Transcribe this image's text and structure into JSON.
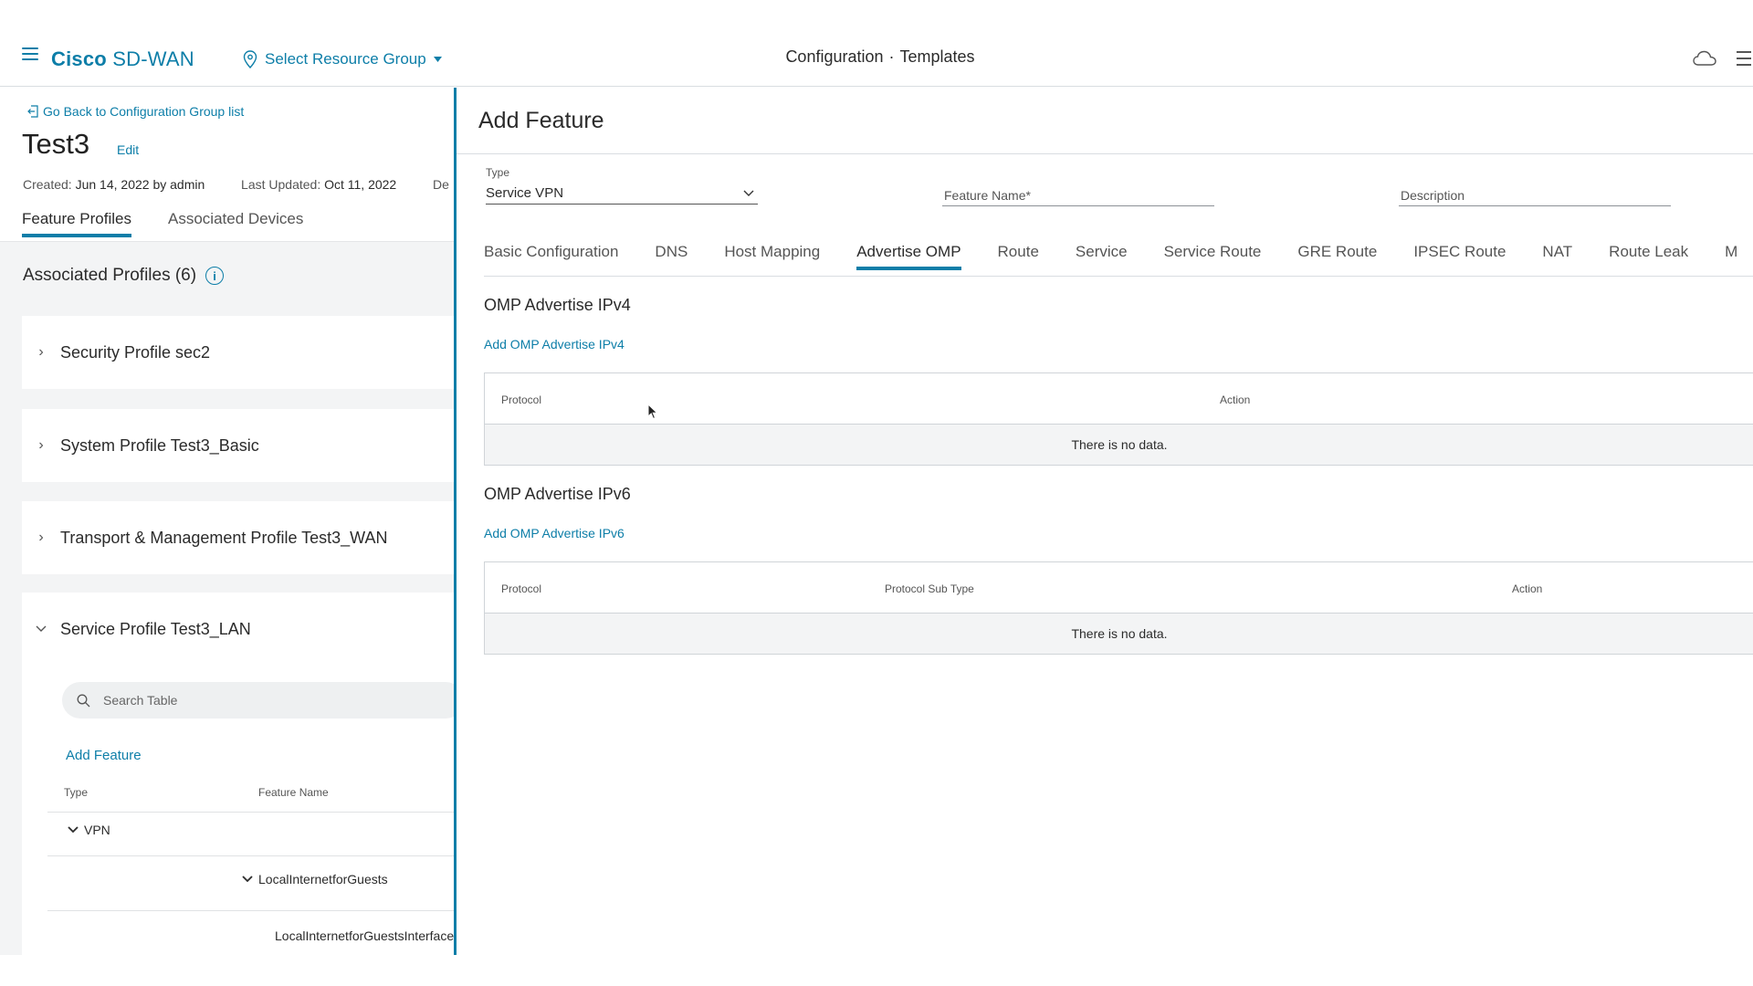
{
  "header": {
    "brand_bold": "Cisco",
    "brand_rest": "SD-WAN",
    "resource_group": "Select Resource Group",
    "title_section": "Configuration",
    "title_separator": "·",
    "title_page": "Templates"
  },
  "left_panel": {
    "back_link": "Go Back to Configuration Group list",
    "group_name": "Test3",
    "edit_label": "Edit",
    "created_label": "Created:",
    "created_value": "Jun 14, 2022 by admin",
    "updated_label": "Last Updated:",
    "updated_value": "Oct 11, 2022",
    "truncated_text": "De",
    "tabs": [
      "Feature Profiles",
      "Associated Devices"
    ],
    "active_tab": "Feature Profiles",
    "associated_profiles_label": "Associated Profiles (6)",
    "profiles": [
      {
        "label": "Security Profile sec2",
        "expanded": false
      },
      {
        "label": "System Profile Test3_Basic",
        "expanded": false
      },
      {
        "label": "Transport & Management Profile Test3_WAN",
        "expanded": false
      },
      {
        "label": "Service Profile Test3_LAN",
        "expanded": true
      }
    ],
    "service_profile": {
      "search_placeholder": "Search Table",
      "add_feature_label": "Add Feature",
      "columns": [
        "Type",
        "Feature Name"
      ],
      "rows": {
        "vpn_label": "VPN",
        "feature_label": "LocalInternetforGuests",
        "interface_label": "LocalInternetforGuestsInterface"
      }
    }
  },
  "drawer": {
    "title": "Add Feature",
    "type_label": "Type",
    "type_value": "Service VPN",
    "feature_name_placeholder": "Feature Name*",
    "description_placeholder": "Description",
    "tabs": [
      "Basic Configuration",
      "DNS",
      "Host Mapping",
      "Advertise OMP",
      "Route",
      "Service",
      "Service Route",
      "GRE Route",
      "IPSEC Route",
      "NAT",
      "Route Leak",
      "M"
    ],
    "active_tab": "Advertise OMP",
    "ipv4": {
      "title": "OMP Advertise IPv4",
      "add_label": "Add OMP Advertise IPv4",
      "columns": [
        "Protocol",
        "Action"
      ],
      "empty_text": "There is no data."
    },
    "ipv6": {
      "title": "OMP Advertise IPv6",
      "add_label": "Add OMP Advertise IPv6",
      "columns": [
        "Protocol",
        "Protocol Sub Type",
        "Action"
      ],
      "empty_text": "There is no data."
    }
  },
  "colors": {
    "accent": "#0d7ea8",
    "panel_bg": "#f3f4f5",
    "border": "#d0d4d8"
  },
  "icons": [
    "hamburger-icon",
    "location-pin-icon",
    "caret-down-icon",
    "cloud-icon",
    "list-icon",
    "back-icon",
    "info-icon",
    "chevron-right-icon",
    "chevron-down-icon",
    "search-icon",
    "mouse-cursor-icon"
  ]
}
